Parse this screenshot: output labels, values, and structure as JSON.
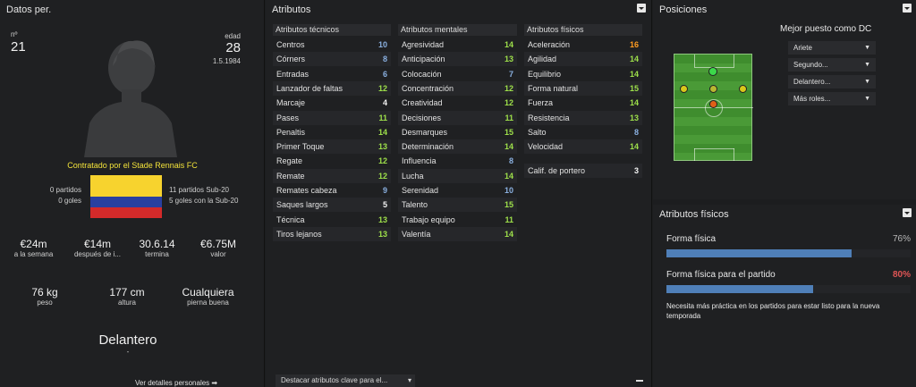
{
  "personal": {
    "title": "Datos per.",
    "number_label": "nº",
    "number": "21",
    "age_label": "edad",
    "age": "28",
    "dob": "1.5.1984",
    "contract_text": "Contratado por el Stade Rennais FC",
    "left_stats": [
      "0 partidos",
      "0 goles"
    ],
    "right_stats": [
      "11 partidos Sub-20",
      "5 goles con la Sub-20"
    ],
    "flag_colors": [
      "#f7d32e",
      "#2940a0",
      "#d42a2a"
    ],
    "money": [
      {
        "value": "€24m",
        "label": "a la semana"
      },
      {
        "value": "€14m",
        "label": "después de i..."
      },
      {
        "value": "30.6.14",
        "label": "termina"
      },
      {
        "value": "€6.75M",
        "label": "valor"
      }
    ],
    "body": [
      {
        "value": "76 kg",
        "label": "peso"
      },
      {
        "value": "177 cm",
        "label": "altura"
      },
      {
        "value": "Cualquiera",
        "label": "pierna buena"
      }
    ],
    "position": "Delantero",
    "position_sub": "-",
    "details_link": "Ver detalles personales ➡"
  },
  "attributes": {
    "title": "Atributos",
    "tecnicos": {
      "header": "Atributos técnicos",
      "rows": [
        {
          "name": "Centros",
          "value": "10",
          "color": "blue"
        },
        {
          "name": "Córners",
          "value": "8",
          "color": "blue"
        },
        {
          "name": "Entradas",
          "value": "6",
          "color": "blue"
        },
        {
          "name": "Lanzador de faltas",
          "value": "12",
          "color": "green"
        },
        {
          "name": "Marcaje",
          "value": "4",
          "color": "white"
        },
        {
          "name": "Pases",
          "value": "11",
          "color": "green"
        },
        {
          "name": "Penaltis",
          "value": "14",
          "color": "green"
        },
        {
          "name": "Primer Toque",
          "value": "13",
          "color": "green"
        },
        {
          "name": "Regate",
          "value": "12",
          "color": "green"
        },
        {
          "name": "Remate",
          "value": "12",
          "color": "green"
        },
        {
          "name": "Remates cabeza",
          "value": "9",
          "color": "blue"
        },
        {
          "name": "Saques largos",
          "value": "5",
          "color": "white"
        },
        {
          "name": "Técnica",
          "value": "13",
          "color": "green"
        },
        {
          "name": "Tiros lejanos",
          "value": "13",
          "color": "green"
        }
      ]
    },
    "mentales": {
      "header": "Atributos mentales",
      "rows": [
        {
          "name": "Agresividad",
          "value": "14",
          "color": "green"
        },
        {
          "name": "Anticipación",
          "value": "13",
          "color": "green"
        },
        {
          "name": "Colocación",
          "value": "7",
          "color": "blue"
        },
        {
          "name": "Concentración",
          "value": "12",
          "color": "green"
        },
        {
          "name": "Creatividad",
          "value": "12",
          "color": "green"
        },
        {
          "name": "Decisiones",
          "value": "11",
          "color": "green"
        },
        {
          "name": "Desmarques",
          "value": "15",
          "color": "green"
        },
        {
          "name": "Determinación",
          "value": "14",
          "color": "green"
        },
        {
          "name": "Influencia",
          "value": "8",
          "color": "blue"
        },
        {
          "name": "Lucha",
          "value": "14",
          "color": "green"
        },
        {
          "name": "Serenidad",
          "value": "10",
          "color": "blue"
        },
        {
          "name": "Talento",
          "value": "15",
          "color": "green"
        },
        {
          "name": "Trabajo equipo",
          "value": "11",
          "color": "green"
        },
        {
          "name": "Valentía",
          "value": "14",
          "color": "green"
        }
      ]
    },
    "fisicos": {
      "header": "Atributos físicos",
      "rows": [
        {
          "name": "Aceleración",
          "value": "16",
          "color": "orange"
        },
        {
          "name": "Agilidad",
          "value": "14",
          "color": "green"
        },
        {
          "name": "Equilibrio",
          "value": "14",
          "color": "green"
        },
        {
          "name": "Forma natural",
          "value": "15",
          "color": "green"
        },
        {
          "name": "Fuerza",
          "value": "14",
          "color": "green"
        },
        {
          "name": "Resistencia",
          "value": "13",
          "color": "green"
        },
        {
          "name": "Salto",
          "value": "8",
          "color": "blue"
        },
        {
          "name": "Velocidad",
          "value": "14",
          "color": "green"
        }
      ],
      "gk": {
        "name": "Calif. de portero",
        "value": "3",
        "color": "white"
      }
    },
    "highlight_select": "Destacar atributos clave para el..."
  },
  "positions": {
    "title": "Posiciones",
    "best_role": "Mejor puesto como DC",
    "roles": [
      "Ariete",
      "Segundo...",
      "Delantero...",
      "Más roles..."
    ]
  },
  "fitness": {
    "title": "Atributos físicos",
    "rows": [
      {
        "label": "Forma física",
        "pct_text": "76%",
        "pct": 76,
        "color": "#b8b8b8"
      },
      {
        "label": "Forma física para el partido",
        "pct_text": "80%",
        "pct": 60,
        "color": "#e05555"
      }
    ],
    "note": "Necesita más práctica en los partidos para estar listo para la nueva temporada"
  }
}
